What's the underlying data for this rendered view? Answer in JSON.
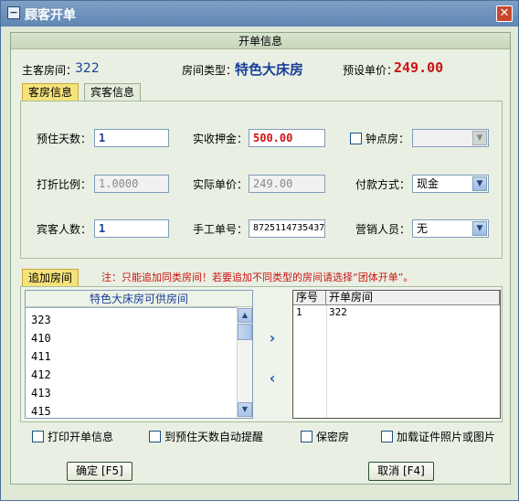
{
  "window": {
    "title": "顾客开单",
    "close_glyph": "✕"
  },
  "section_header": "开单信息",
  "info": {
    "main_room_label": "主客房间：",
    "main_room_value": "322",
    "room_type_label": "房间类型：",
    "room_type_value": "特色大床房",
    "preset_price_label": "预设单价：",
    "preset_price_value": "249.00"
  },
  "tabs": [
    {
      "label": "客房信息",
      "active": true
    },
    {
      "label": "宾客信息",
      "active": false
    }
  ],
  "form": {
    "stay_days_label": "预住天数：",
    "stay_days_value": "1",
    "deposit_label": "实收押金：",
    "deposit_value": "500.00",
    "hourly_label": "钟点房：",
    "hourly_checked": false,
    "hourly_value": "",
    "discount_label": "打折比例：",
    "discount_value": "1.0000",
    "actual_price_label": "实际单价：",
    "actual_price_value": "249.00",
    "payment_label": "付款方式：",
    "payment_value": "现金",
    "guests_label": "宾客人数：",
    "guests_value": "1",
    "manual_no_label": "手工单号：",
    "manual_no_value": "8725114735437",
    "sales_label": "营销人员：",
    "sales_value": "无"
  },
  "add_room": {
    "tab_label": "追加房间",
    "note": "注：只能追加同类房间！若要追加不同类型的房间请选择“团体开单”。",
    "available_header": "特色大床房可供房间",
    "available_rooms": [
      "323",
      "410",
      "411",
      "412",
      "413",
      "415"
    ],
    "table_headers": [
      "序号",
      "开单房间"
    ],
    "table_rows": [
      {
        "no": "1",
        "room": "322"
      }
    ]
  },
  "options": [
    {
      "label": "打印开单信息",
      "checked": false
    },
    {
      "label": "到预住天数自动提醒",
      "checked": false
    },
    {
      "label": "保密房",
      "checked": false
    },
    {
      "label": "加载证件照片或图片",
      "checked": false
    }
  ],
  "buttons": {
    "ok": "确定 [F5]",
    "cancel": "取消 [F4]"
  },
  "colors": {
    "accent_red": "#cc1111",
    "accent_blue": "#1a3f9a",
    "tab_active": "#f6e27b"
  }
}
